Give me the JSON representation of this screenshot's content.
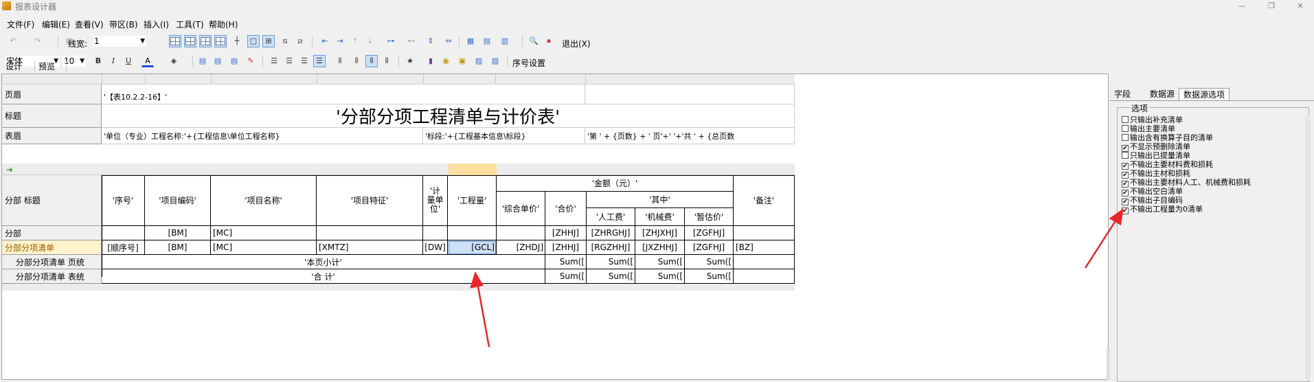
{
  "window": {
    "title": "报表设计器"
  },
  "menu": [
    "文件(F)",
    "编辑(E)",
    "查看(V)",
    "带区(B)",
    "插入(I)",
    "工具(T)",
    "帮助(H)"
  ],
  "toolbar1": {
    "line_width_label": "线宽:",
    "line_width_value": "1",
    "exit_label": "退出(X)"
  },
  "toolbar2": {
    "font_name": "宋体",
    "font_size": "10",
    "bold": "B",
    "italic": "I",
    "underline": "U",
    "font_color": "A",
    "star": "★",
    "seq_settings": "序号设置"
  },
  "tabs": [
    "设计",
    "预览"
  ],
  "bands": {
    "header": {
      "label": "页眉",
      "text": "'【表10.2.2-16】'"
    },
    "title": {
      "label": "标题",
      "text": "'分部分项工程清单与计价表'"
    },
    "table_header": {
      "label": "表眉",
      "unit": "'单位（专业）工程名称:'+{工程信息\\单位工程名称}",
      "section": "'标段:'+{工程基本信息\\标段}",
      "page": "'第 ' + {页数} + ' 页'+'  '+'共 ' + {总页数"
    }
  },
  "columns": {
    "group_label": "分部 标题",
    "seq": "'序号'",
    "code": "'项目编码'",
    "name": "'项目名称'",
    "feature": "'项目特征'",
    "unit": "'计量单位'",
    "qty": "'工程量'",
    "amount": "'金额（元）'",
    "unit_price": "'综合单价'",
    "total": "'合价'",
    "among": "'其中'",
    "labor": "'人工费'",
    "machine": "'机械费'",
    "provisional": "'暂估价'",
    "remark": "'备注'"
  },
  "rows": {
    "division": {
      "label": "分部",
      "code": "[BM]",
      "name": "[MC]",
      "total": "[ZHHJ]",
      "labor": "[ZHRGHJ]",
      "machine": "[ZHJXHJ]",
      "prov": "[ZGFHJ]"
    },
    "item": {
      "label": "分部分项清单",
      "seq": "[顺序号]",
      "code": "[BM]",
      "name": "[MC]",
      "feature": "[XMTZ]",
      "unit": "[DW]",
      "qty": "[GCL]",
      "price": "[ZHDJ]",
      "total": "[ZHHJ]",
      "labor": "[RGZHHJ]",
      "machine": "[JXZHHJ]",
      "prov": "[ZGFHJ]",
      "remark": "[BZ]"
    },
    "page_foot": {
      "label": "分部分项清单 页统",
      "text": "'本页小计'",
      "sum": "Sum(["
    },
    "table_foot": {
      "label": "分部分项清单 表统",
      "text": "'合    计'",
      "sum": "Sum(["
    }
  },
  "panel": {
    "tabs": [
      "字段",
      "数据源",
      "数据源选项"
    ],
    "group": "选项",
    "options": [
      {
        "label": "只输出补充清单",
        "checked": false
      },
      {
        "label": "输出主要清单",
        "checked": false
      },
      {
        "label": "输出含有换算子目的清单",
        "checked": false
      },
      {
        "label": "不显示预删除清单",
        "checked": true
      },
      {
        "label": "只输出已提量清单",
        "checked": false
      },
      {
        "label": "不输出主要材料费和损耗",
        "checked": true
      },
      {
        "label": "不输出主材和损耗",
        "checked": true
      },
      {
        "label": "不输出主要材料人工、机械费和损耗",
        "checked": true
      },
      {
        "label": "不输出空白清单",
        "checked": true
      },
      {
        "label": "不输出子目编码",
        "checked": true
      },
      {
        "label": "不输出工程量为0清单",
        "checked": true
      }
    ]
  },
  "colors": {
    "annotation_arrow": "#e8262a",
    "selected_cell": "#cde0f7",
    "highlight_column": "#ffdfa0"
  }
}
